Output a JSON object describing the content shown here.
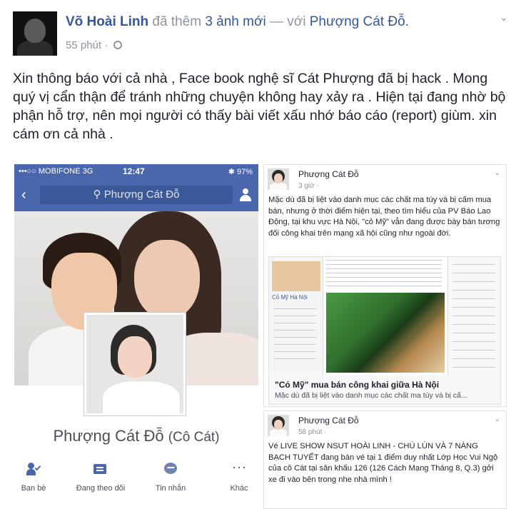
{
  "post": {
    "author": "Võ Hoài Linh",
    "verb": "đã thêm",
    "photos_link": "3 ảnh mới",
    "with_prefix": "— với",
    "tagged": "Phượng Cát Đỗ.",
    "time": "55 phút · ",
    "text": "Xin thông báo với cả nhà , Face book nghệ sĩ Cát Phượng đã bị hack . Mong quý vị cẩn thận để tránh những chuyện không hay xảy ra . Hiện tại đang nhờ bộ phận hỗ trợ, nên mọi người có thấy bài viết xấu nhớ báo cáo (report) giùm. xin cám ơn cả nhà ."
  },
  "phone": {
    "carrier": "•••○○ MOBIFONE  3G",
    "clock": "12:47",
    "battery": "✱ 97%",
    "search_text": "Phượng Cát Đỗ",
    "profile_name": "Phượng Cát Đỗ",
    "profile_nick": "(Cô Cát)",
    "actions": {
      "friends": "Bạn bè",
      "following": "Đang theo dõi",
      "message": "Tin nhắn",
      "more": "Khác"
    }
  },
  "feed": [
    {
      "name": "Phượng Cát Đỗ",
      "time": "3 giờ ·",
      "text": "Mặc dù đã bị liệt vào danh mục các chất ma túy và bị cấm mua bán, nhưng ở thời điểm hiện tại, theo tìm hiểu của PV Báo Lao Động, tại khu vực Hà Nội, \"cỏ Mỹ\" vẫn đang được bày bán tương đối công khai trên mạng xã hội cũng như ngoài đời.",
      "preview_page_label": "Cỏ Mỹ Hà Nội",
      "preview_title": "\"Cỏ Mỹ\" mua bán công khai giữa Hà Nội",
      "preview_desc": "Mặc dù đã bị liệt vào danh mục các chất ma túy và bị cấ..."
    },
    {
      "name": "Phượng Cát Đỗ",
      "time": "58 phút ·",
      "text": "Vé LIVE SHOW NSUT HOÀI LINH - CHÚ LÙN VÀ 7 NÀNG BẠCH TUYẾT đang bán vé tại 1 điểm duy nhất Lớp Học Vui Ngộ của cô Cát tại sân khấu 126 (126 Cách Mạng Tháng 8, Q.3) gởi xe đi vào bên trong nhe nhà mình !"
    }
  ],
  "colors": {
    "link": "#365899",
    "fb_blue": "#4a67ad",
    "meta_gray": "#90949c"
  }
}
